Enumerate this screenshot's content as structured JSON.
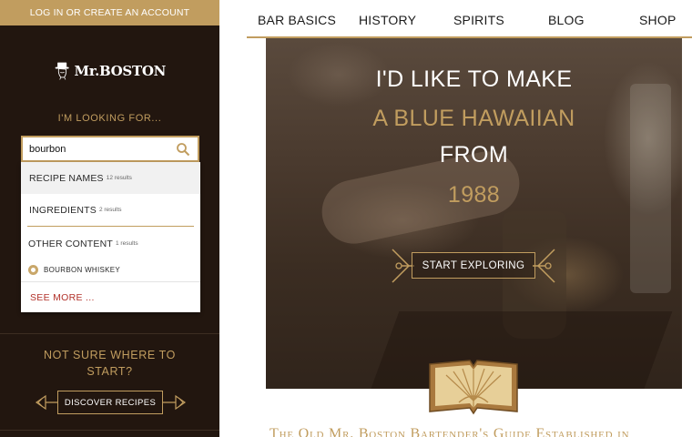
{
  "sidebar": {
    "login_label": "LOG IN OR CREATE AN ACCOUNT",
    "logo_text": "Mr.BOSTON",
    "looking_for": "I'M LOOKING FOR...",
    "search": {
      "value": "bourbon",
      "button_icon": "search-icon"
    },
    "dropdown": {
      "recipe_names_label": "RECIPE NAMES",
      "recipe_names_count": "12 results",
      "ingredients_label": "INGREDIENTS",
      "ingredients_count": "2 results",
      "other_content_label": "OTHER CONTENT",
      "other_content_count": "1 results",
      "item_label": "BOURBON WHISKEY",
      "see_more": "SEE MORE ..."
    },
    "not_sure_line1": "NOT SURE WHERE TO",
    "not_sure_line2": "START?",
    "discover_label": "DISCOVER RECIPES"
  },
  "nav": {
    "items": [
      "BAR BASICS",
      "HISTORY",
      "SPIRITS",
      "BLOG",
      "SHOP"
    ]
  },
  "hero": {
    "line1": "I'D LIKE TO MAKE",
    "line2": "A BLUE HAWAIIAN",
    "line3": "FROM",
    "line4": "1988",
    "explore_label": "START EXPLORING"
  },
  "tagline": "The Old Mr. Boston Bartender's Guide Established in",
  "colors": {
    "gold": "#c19d5f",
    "sidebar_bg": "#22160f",
    "see_more_red": "#b2322a"
  }
}
